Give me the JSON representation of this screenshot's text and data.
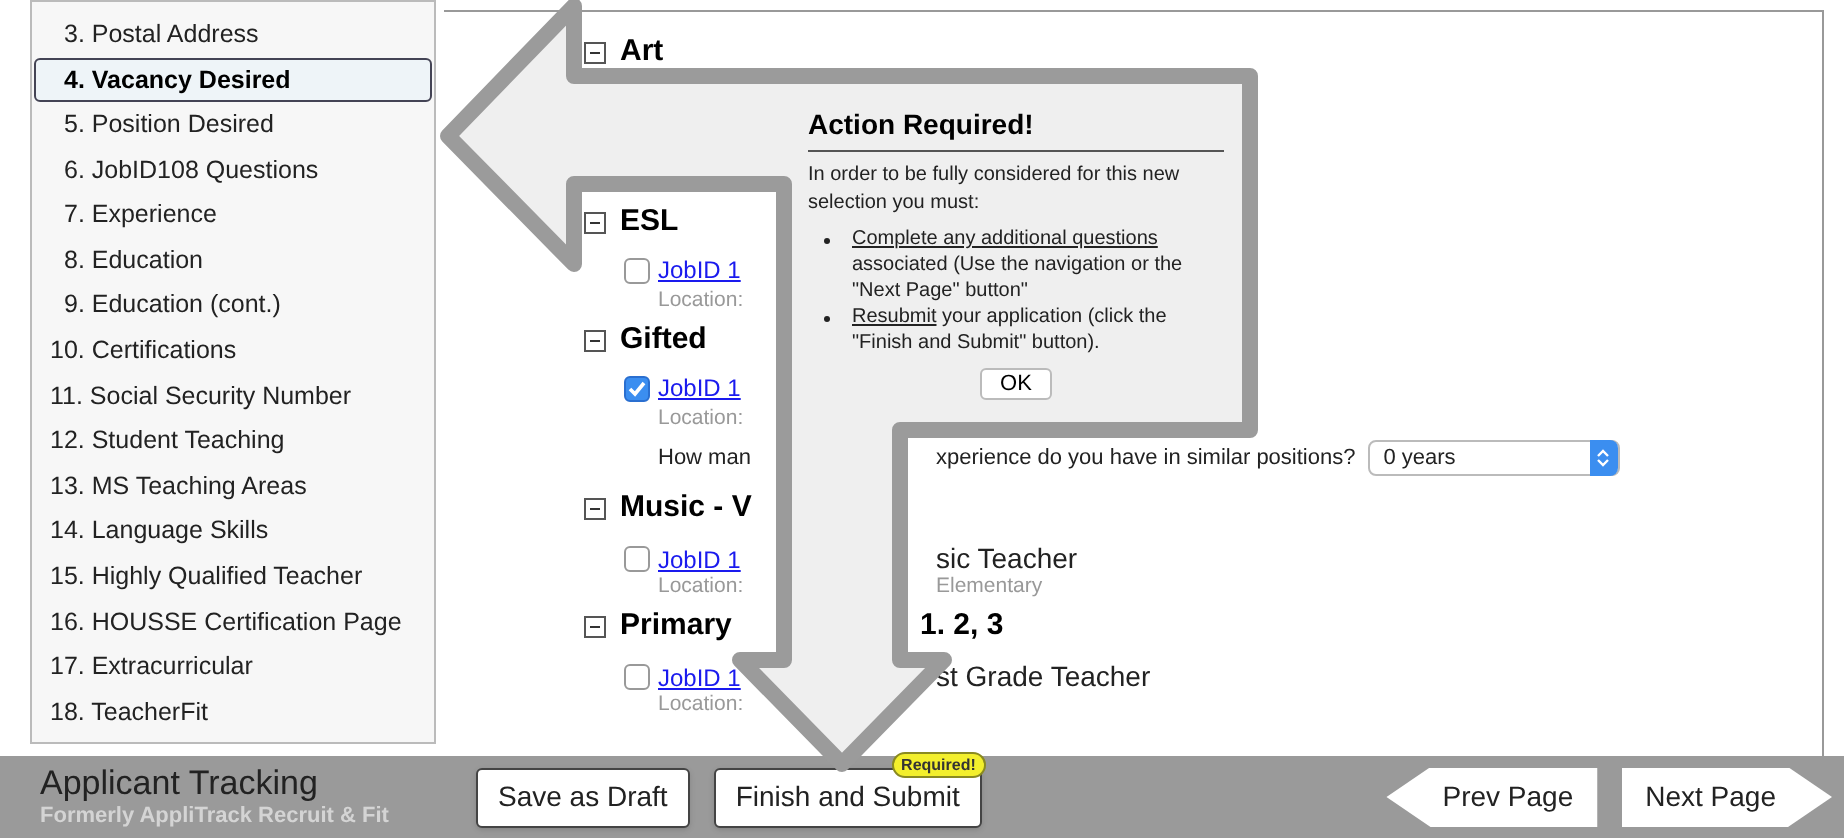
{
  "sidebar": {
    "items": [
      {
        "label": "3. Postal Address",
        "selected": false
      },
      {
        "label": "4. Vacancy Desired",
        "selected": true
      },
      {
        "label": "5. Position Desired",
        "selected": false
      },
      {
        "label": "6. JobID108 Questions",
        "selected": false
      },
      {
        "label": "7. Experience",
        "selected": false
      },
      {
        "label": "8. Education",
        "selected": false
      },
      {
        "label": "9. Education (cont.)",
        "selected": false
      },
      {
        "label": "10. Certifications",
        "selected": false
      },
      {
        "label": "11. Social Security Number",
        "selected": false
      },
      {
        "label": "12. Student Teaching",
        "selected": false
      },
      {
        "label": "13. MS Teaching Areas",
        "selected": false
      },
      {
        "label": "14. Language Skills",
        "selected": false
      },
      {
        "label": "15. Highly Qualified Teacher",
        "selected": false
      },
      {
        "label": "16. HOUSSE Certification Page",
        "selected": false
      },
      {
        "label": "17. Extracurricular",
        "selected": false
      },
      {
        "label": "18. TeacherFit",
        "selected": false
      }
    ]
  },
  "sections": [
    {
      "title_parts": [
        "Art"
      ],
      "expanded": true
    },
    {
      "title_parts": [
        "ESL"
      ],
      "expanded": true,
      "jobs": [
        {
          "link": "JobID 1",
          "location_parts": [
            "Location:"
          ],
          "checked": false
        }
      ]
    },
    {
      "title_parts": [
        "Gifted"
      ],
      "expanded": true,
      "jobs": [
        {
          "link": "JobID 1",
          "location_parts": [
            "Location:"
          ],
          "checked": true,
          "question": {
            "text_parts": [
              "How man",
              "xperience do you have in similar positions?"
            ],
            "value": "0 years"
          }
        }
      ]
    },
    {
      "title_parts": [
        "Music - V"
      ],
      "expanded": true,
      "jobs": [
        {
          "link": "JobID 1",
          "title": "sic Teacher",
          "location_parts": [
            "Location:",
            "Elementary"
          ],
          "checked": false
        }
      ]
    },
    {
      "title_parts": [
        "Primary",
        "1. 2, 3"
      ],
      "expanded": true,
      "jobs": [
        {
          "link": "JobID 1",
          "title": "st Grade Teacher",
          "location_parts": [
            "Location:"
          ],
          "checked": false
        }
      ]
    }
  ],
  "dialog": {
    "title": "Action Required!",
    "intro": "In order to be fully considered for this new selection you must:",
    "bullets": [
      {
        "link": "Complete any additional questions",
        "rest": "associated (Use the navigation or the \"Next Page\" button\""
      },
      {
        "link": "Resubmit",
        "rest": "your application (click the \"Finish and Submit\" button)."
      }
    ],
    "button": "OK"
  },
  "brand": {
    "title": "Applicant Tracking",
    "subtitle": "Formerly AppliTrack Recruit & Fit"
  },
  "footer_buttons": [
    {
      "label": "Save as Draft",
      "kind": "plain"
    },
    {
      "label": "Finish and Submit",
      "kind": "plain",
      "badge": "Required!"
    },
    {
      "label": "Prev Page",
      "kind": "prev"
    },
    {
      "label": "Next Page",
      "kind": "next"
    }
  ]
}
